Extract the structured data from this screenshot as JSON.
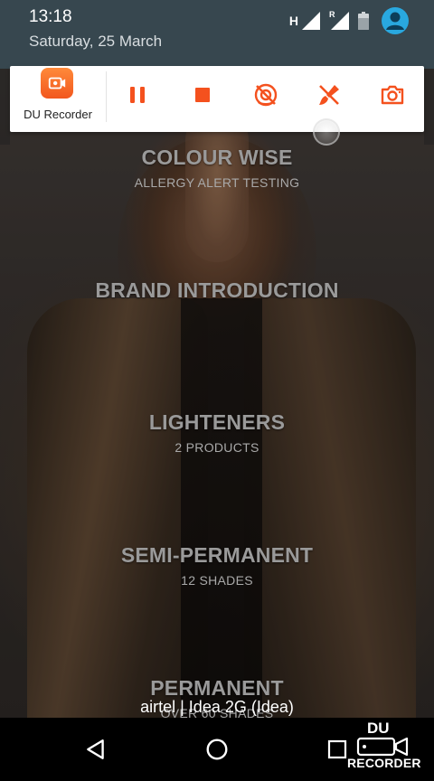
{
  "status_bar": {
    "time": "13:18",
    "date": "Saturday, 25 March",
    "network_type": "H",
    "roaming_badge": "R"
  },
  "recorder": {
    "app_label": "DU Recorder",
    "accent_color": "#f4511e",
    "buttons": [
      "pause-icon",
      "stop-icon",
      "camera-off-icon",
      "brush-off-icon",
      "screenshot-camera-icon"
    ]
  },
  "menu": [
    {
      "title": "COLOUR WISE",
      "subtitle": "ALLERGY ALERT TESTING"
    },
    {
      "title": "BRAND INTRODUCTION",
      "subtitle": ""
    },
    {
      "title": "LIGHTENERS",
      "subtitle": "2 PRODUCTS"
    },
    {
      "title": "SEMI-PERMANENT",
      "subtitle": "12 SHADES"
    },
    {
      "title": "PERMANENT",
      "subtitle": "OVER 60 SHADES"
    }
  ],
  "carrier": "airtel | Idea 2G (Idea)",
  "watermark": {
    "line1": "DU",
    "line2": "RECORDER"
  }
}
